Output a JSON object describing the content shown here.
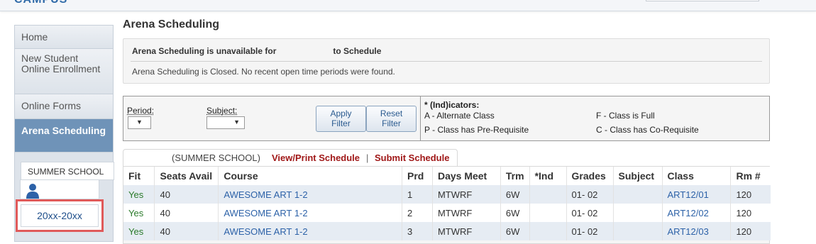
{
  "app": {
    "logo_fragment": "CAMPUS"
  },
  "sidebar": {
    "items": [
      {
        "label": "Home"
      },
      {
        "label": "New Student Online Enrollment"
      },
      {
        "label": "Online Forms"
      },
      {
        "label": "Arena Scheduling"
      }
    ],
    "school_label": "SUMMER SCHOOL",
    "year_label": "20xx-20xx",
    "colors": {
      "active": "#6f93b8",
      "highlight": "#e05a5a"
    }
  },
  "page": {
    "title": "Arena Scheduling"
  },
  "notice": {
    "title_left": "Arena Scheduling is unavailable for",
    "title_right": "to Schedule",
    "message": "Arena Scheduling is Closed. No recent open time periods were found."
  },
  "filters": {
    "period_label": "Period:",
    "subject_label": "Subject:",
    "apply_label_1": "Apply",
    "apply_label_2": "Filter",
    "reset_label_1": "Reset",
    "reset_label_2": "Filter",
    "indicators_title": "* (Ind)icators:",
    "indicators": [
      "A - Alternate Class",
      "P - Class has Pre-Requisite",
      "F - Class is Full",
      "C - Class has Co-Requisite"
    ]
  },
  "tabs": {
    "school": "(SUMMER SCHOOL)",
    "view_print": "View/Print Schedule",
    "separator": "|",
    "submit": "Submit Schedule"
  },
  "table": {
    "headers": [
      "Fit",
      "Seats Avail",
      "Course",
      "Prd",
      "Days Meet",
      "Trm",
      "*Ind",
      "Grades",
      "Subject",
      "Class",
      "Rm #"
    ],
    "rows": [
      [
        "Yes",
        "40",
        "AWESOME ART 1-2",
        "1",
        "MTWRF",
        "6W",
        "",
        "01- 02",
        "",
        "ART12/01",
        "120"
      ],
      [
        "Yes",
        "40",
        "AWESOME ART 1-2",
        "2",
        "MTWRF",
        "6W",
        "",
        "01- 02",
        "",
        "ART12/02",
        "120"
      ],
      [
        "Yes",
        "40",
        "AWESOME ART 1-2",
        "3",
        "MTWRF",
        "6W",
        "",
        "01- 02",
        "",
        "ART12/03",
        "120"
      ]
    ]
  }
}
